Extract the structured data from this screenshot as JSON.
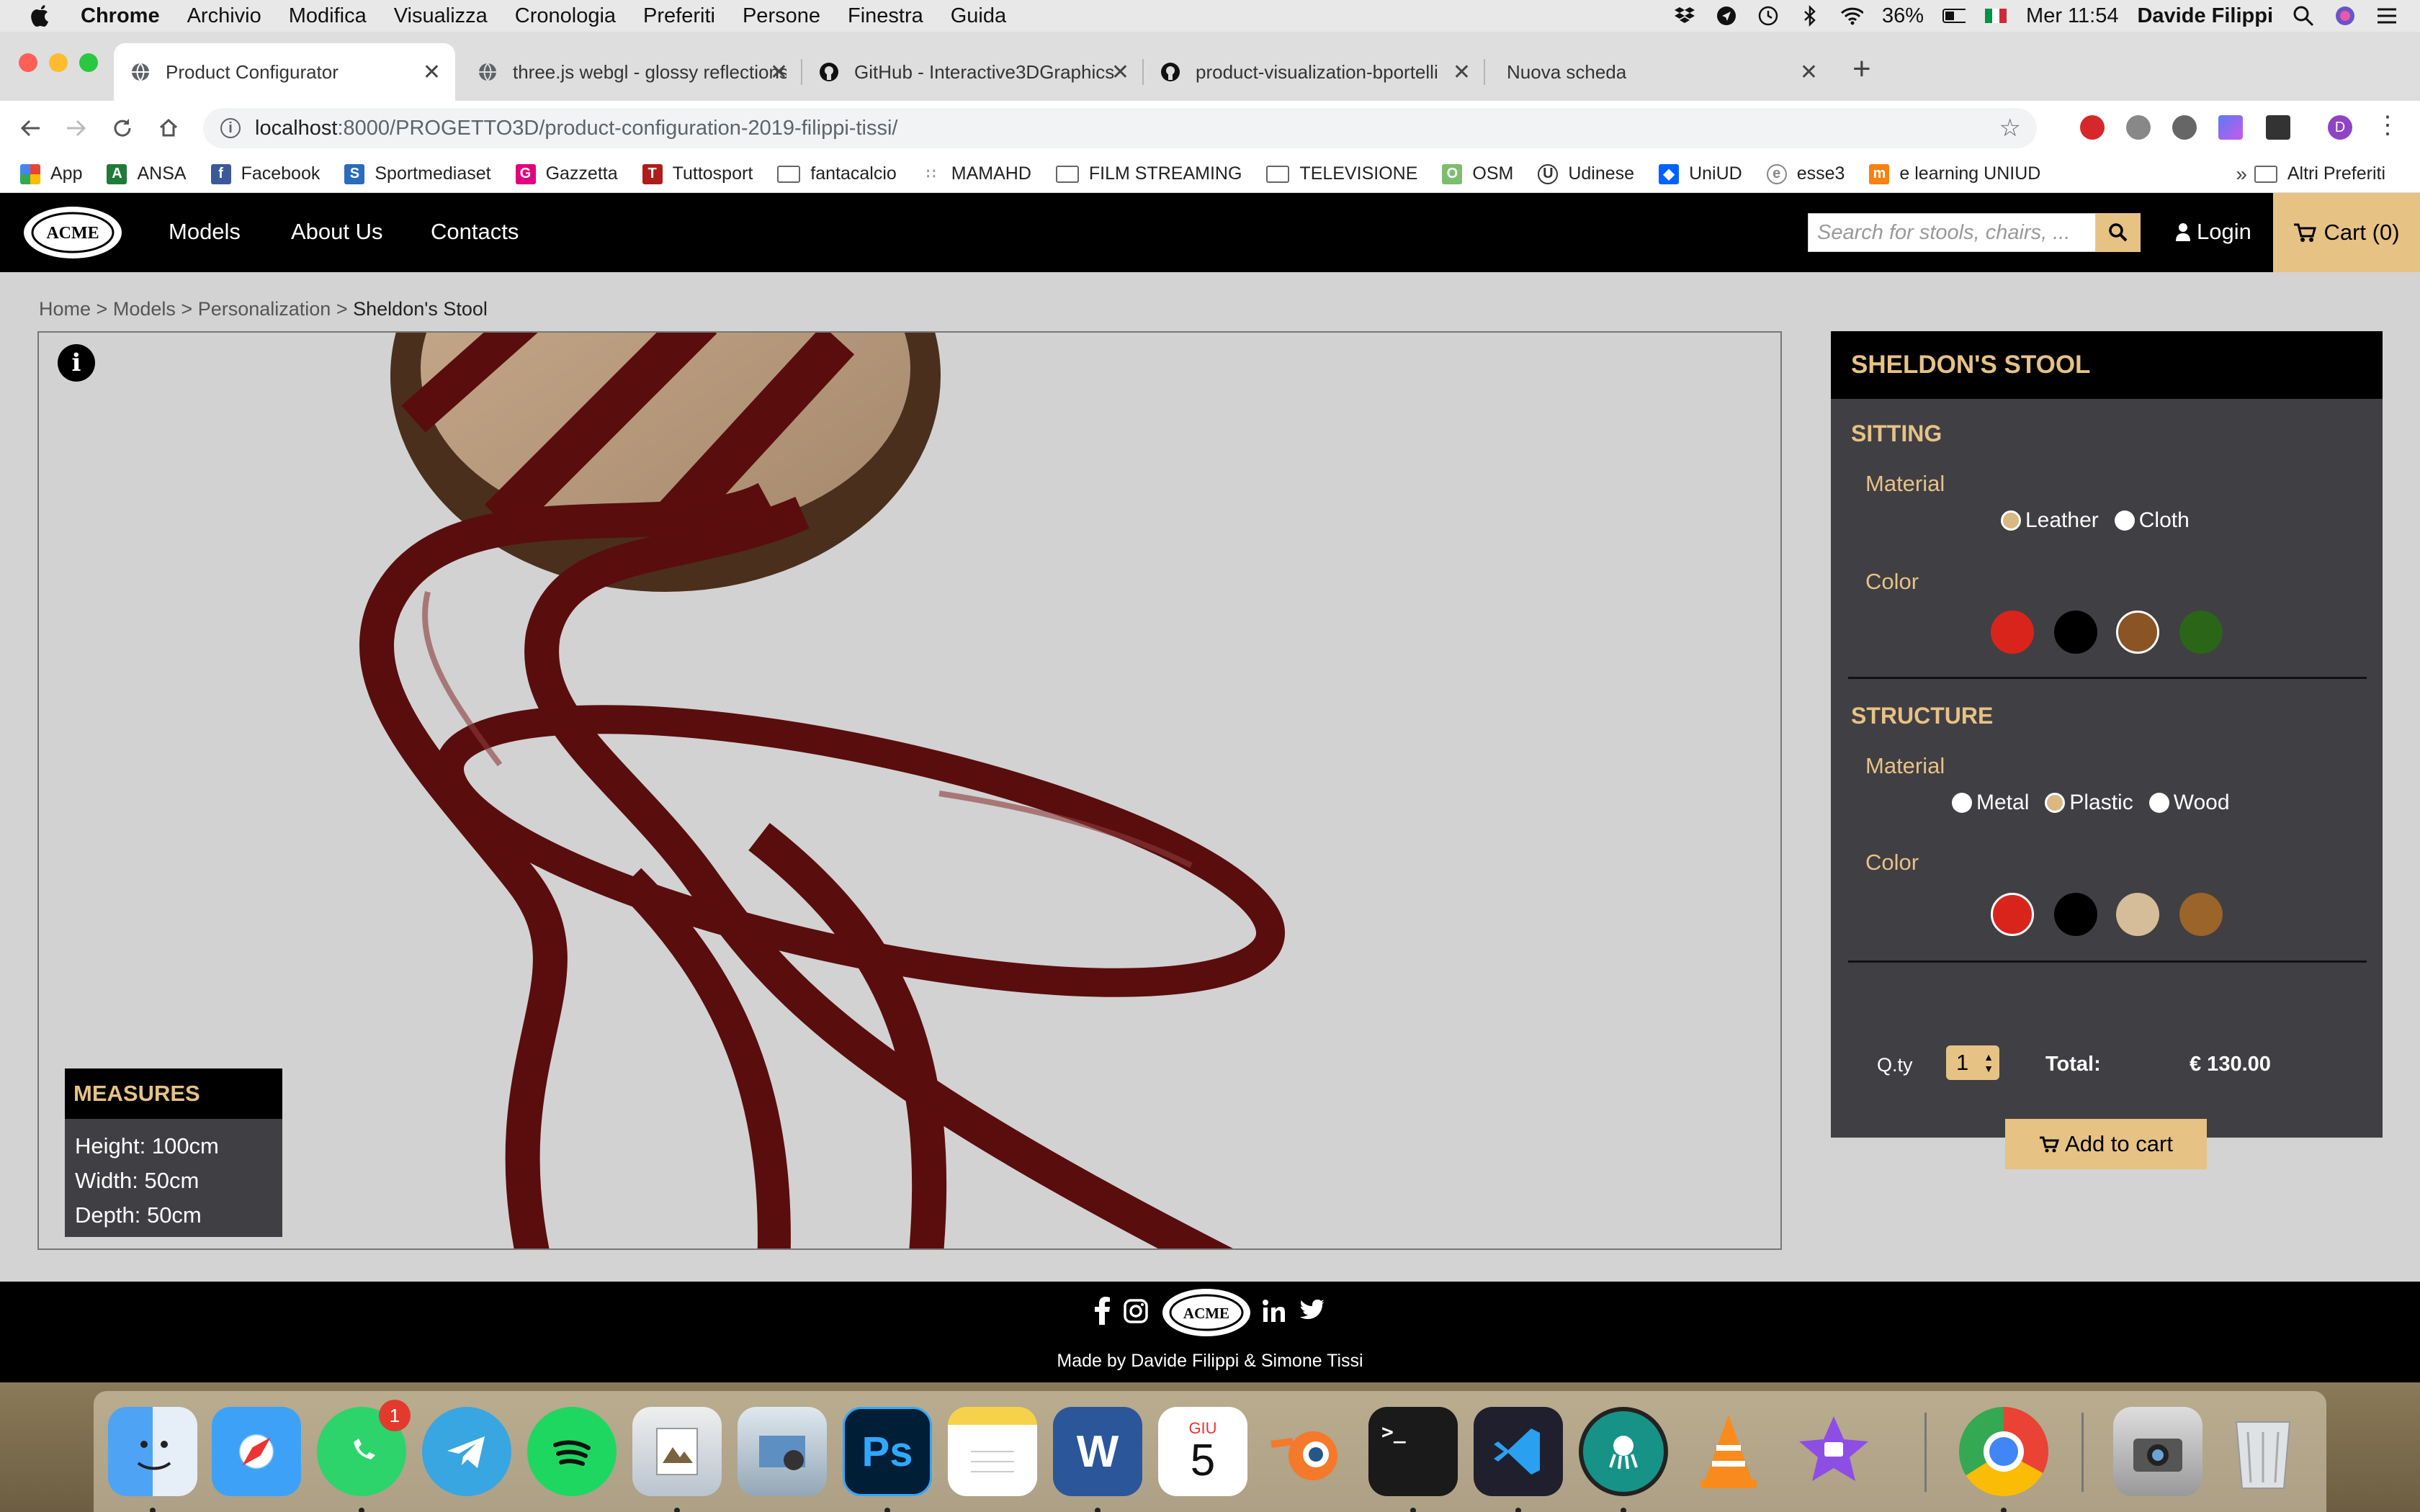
{
  "menubar": {
    "app_name": "Chrome",
    "items": [
      "Archivio",
      "Modifica",
      "Visualizza",
      "Cronologia",
      "Preferiti",
      "Persone",
      "Finestra",
      "Guida"
    ],
    "battery": "36%",
    "clock": "Mer 11:54",
    "user": "Davide Filippi"
  },
  "tabs": [
    {
      "label": "Product Configurator",
      "active": true
    },
    {
      "label": "three.js webgl - glossy reflections",
      "active": false
    },
    {
      "label": "GitHub - Interactive3DGraphics",
      "active": false
    },
    {
      "label": "product-visualization-bportelli",
      "active": false
    },
    {
      "label": "Nuova scheda",
      "active": false
    }
  ],
  "address": {
    "host": "localhost",
    "path": ":8000/PROGETTO3D/product-configuration-2019-filippi-tissi/"
  },
  "profile_initial": "D",
  "bookmarks": [
    {
      "label": "App",
      "icon": "apps-grid-icon"
    },
    {
      "label": "ANSA",
      "icon": "ansa-icon"
    },
    {
      "label": "Facebook",
      "icon": "facebook-icon"
    },
    {
      "label": "Sportmediaset",
      "icon": "sportmediaset-icon"
    },
    {
      "label": "Gazzetta",
      "icon": "gazzetta-icon"
    },
    {
      "label": "Tuttosport",
      "icon": "tuttosport-icon"
    },
    {
      "label": "fantacalcio",
      "icon": "folder-icon"
    },
    {
      "label": "MAMAHD",
      "icon": "dots-icon"
    },
    {
      "label": "FILM STREAMING",
      "icon": "folder-icon"
    },
    {
      "label": "TELEVISIONE",
      "icon": "folder-icon"
    },
    {
      "label": "OSM",
      "icon": "osm-icon"
    },
    {
      "label": "Udinese",
      "icon": "udinese-icon"
    },
    {
      "label": "UniUD",
      "icon": "dropbox-icon"
    },
    {
      "label": "esse3",
      "icon": "esse3-icon"
    },
    {
      "label": "e learning UNIUD",
      "icon": "moodle-icon"
    }
  ],
  "bookmarks_more": "»",
  "bookmarks_other": "Altri Preferiti",
  "site": {
    "logo_text": "ACME",
    "nav": [
      "Models",
      "About Us",
      "Contacts"
    ],
    "search_placeholder": "Search for stools, chairs, ...",
    "login": "Login",
    "cart": "Cart (0)"
  },
  "breadcrumb": {
    "items": [
      "Home",
      "Models",
      "Personalization"
    ],
    "separator": ">",
    "current": "Sheldon's Stool"
  },
  "measures": {
    "title": "MEASURES",
    "height": "Height: 100cm",
    "width": "Width: 50cm",
    "depth": "Depth: 50cm"
  },
  "product": {
    "title": "SHELDON'S STOOL",
    "sitting": {
      "title": "SITTING",
      "material_label": "Material",
      "materials": [
        {
          "label": "Leather",
          "selected": true
        },
        {
          "label": "Cloth",
          "selected": false
        }
      ],
      "color_label": "Color",
      "colors": [
        {
          "hex": "#d9241c",
          "selected": false
        },
        {
          "hex": "#000000",
          "selected": false
        },
        {
          "hex": "#8a5424",
          "selected": true
        },
        {
          "hex": "#2a6518",
          "selected": false
        }
      ]
    },
    "structure": {
      "title": "STRUCTURE",
      "material_label": "Material",
      "materials": [
        {
          "label": "Metal",
          "selected": false
        },
        {
          "label": "Plastic",
          "selected": true
        },
        {
          "label": "Wood",
          "selected": false
        }
      ],
      "color_label": "Color",
      "colors": [
        {
          "hex": "#d9241c",
          "selected": true
        },
        {
          "hex": "#000000",
          "selected": false
        },
        {
          "hex": "#d4bd98",
          "selected": false
        },
        {
          "hex": "#9b6428",
          "selected": false
        }
      ]
    },
    "qty_label": "Q.ty",
    "qty": "1",
    "total_label": "Total:",
    "total": "€ 130.00",
    "add_to_cart": "Add to cart"
  },
  "footer": {
    "credit": "Made by Davide Filippi & Simone Tissi"
  },
  "dock": {
    "apps": [
      "Finder",
      "Safari",
      "WhatsApp",
      "Telegram",
      "Spotify",
      "Preview",
      "Image Capture",
      "Photoshop",
      "Notes",
      "Word",
      "Calendar",
      "Blender",
      "Terminal",
      "Visual Studio Code",
      "GitKraken",
      "VLC",
      "iMovie",
      "Chrome",
      "Screenshot",
      "Trash"
    ],
    "whatsapp_badge": "1",
    "photoshop_label": "Ps",
    "word_label": "W",
    "calendar_month": "GIU",
    "calendar_day": "5"
  },
  "colors": {
    "accent": "#e6c285",
    "panel_bg": "#403f44",
    "stool_frame": "#5a0d0d"
  }
}
